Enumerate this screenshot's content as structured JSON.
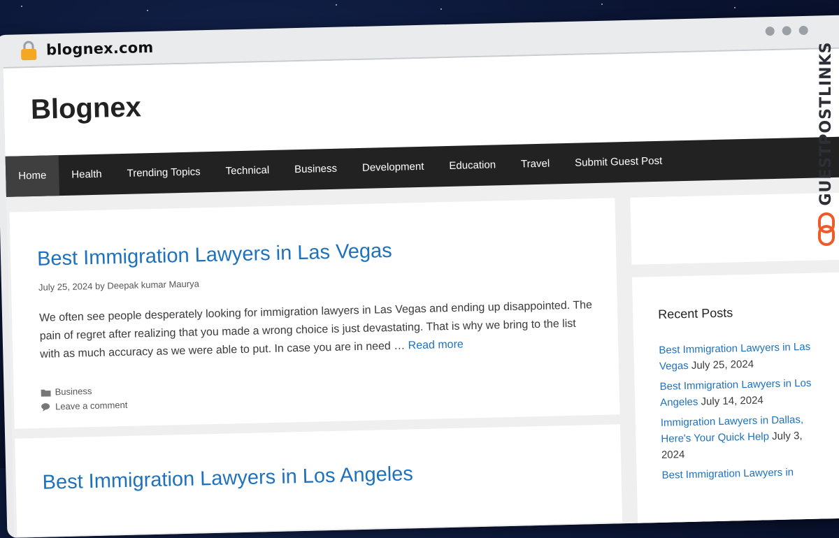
{
  "browser": {
    "url": "blognex.com",
    "lock_icon": "lock-icon",
    "window_controls": [
      "dot",
      "dot",
      "dot"
    ]
  },
  "site": {
    "title": "Blognex"
  },
  "nav": {
    "items": [
      {
        "label": "Home",
        "active": true
      },
      {
        "label": "Health"
      },
      {
        "label": "Trending Topics"
      },
      {
        "label": "Technical"
      },
      {
        "label": "Business"
      },
      {
        "label": "Development"
      },
      {
        "label": "Education"
      },
      {
        "label": "Travel"
      },
      {
        "label": "Submit Guest Post"
      }
    ]
  },
  "posts": [
    {
      "title": "Best Immigration Lawyers in Las Vegas",
      "date": "July 25, 2024",
      "by": "by",
      "author": "Deepak kumar Maurya",
      "excerpt": "We often see people desperately looking for immigration lawyers in Las Vegas and ending up disappointed. The pain of regret after realizing that you made a wrong choice is just devastating. That is why we bring to the list with as much accuracy as we were able to put. In case you are in need …",
      "read_more": "Read more",
      "category": "Business",
      "comment": "Leave a comment"
    },
    {
      "title": "Best Immigration Lawyers in Los Angeles"
    }
  ],
  "sidebar": {
    "recent_title": "Recent Posts",
    "recent": [
      {
        "title": "Best Immigration Lawyers in Las Vegas",
        "date": "July 25, 2024"
      },
      {
        "title": "Best Immigration Lawyers in Los Angeles",
        "date": "July 14, 2024"
      },
      {
        "title": "Immigration Lawyers in Dallas, Here's Your Quick Help",
        "date": "July 3, 2024"
      },
      {
        "title": "Best Immigration Lawyers in",
        "date": ""
      }
    ]
  },
  "watermark": {
    "text": "GUESTPOSTLINKS",
    "accent": "#f05a28"
  },
  "colors": {
    "link": "#1e72bd",
    "nav_bg": "#222222",
    "nav_active": "#3f3f3f"
  }
}
